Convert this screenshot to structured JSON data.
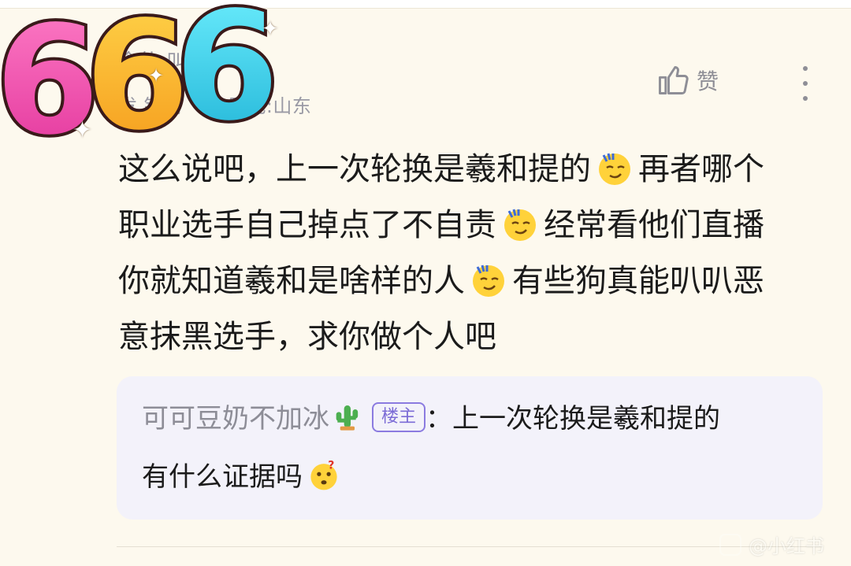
{
  "sticker": {
    "text": "666"
  },
  "post": {
    "user_name": "食仙-叫 ·",
    "meta_time": "发 钟前",
    "meta_dot": "•",
    "meta_ip": "IP属地:山东",
    "like_label": "赞",
    "lines": [
      {
        "a": "这么说吧，上一次轮换是羲和提的",
        "b": "再者哪个"
      },
      {
        "a": "职业选手自己掉点了不自责",
        "b": "经常看他们直播"
      },
      {
        "a": "你就知道羲和是啥样的人",
        "b": "有些狗真能叭叭恶"
      },
      {
        "a": "意抹黑选手，求你做个人吧",
        "b": ""
      }
    ]
  },
  "reply": {
    "user": "可可豆奶不加冰",
    "badge": "楼主",
    "colon": "：",
    "text_line1": "上一次轮换是羲和提的",
    "text_line2": "有什么证据吗"
  },
  "watermark": {
    "text": "@小红书"
  },
  "colors": {
    "accent": "#7b6bd6",
    "background": "#fdf9ee",
    "reply_bg": "#f3f2fa",
    "muted": "#9a9aa5"
  },
  "icons": {
    "like": "thumbs-up-icon",
    "more": "more-vertical-icon",
    "emoji": "smug-face-emoji",
    "cactus": "cactus-emoji",
    "thinking": "thinking-face-emoji"
  }
}
